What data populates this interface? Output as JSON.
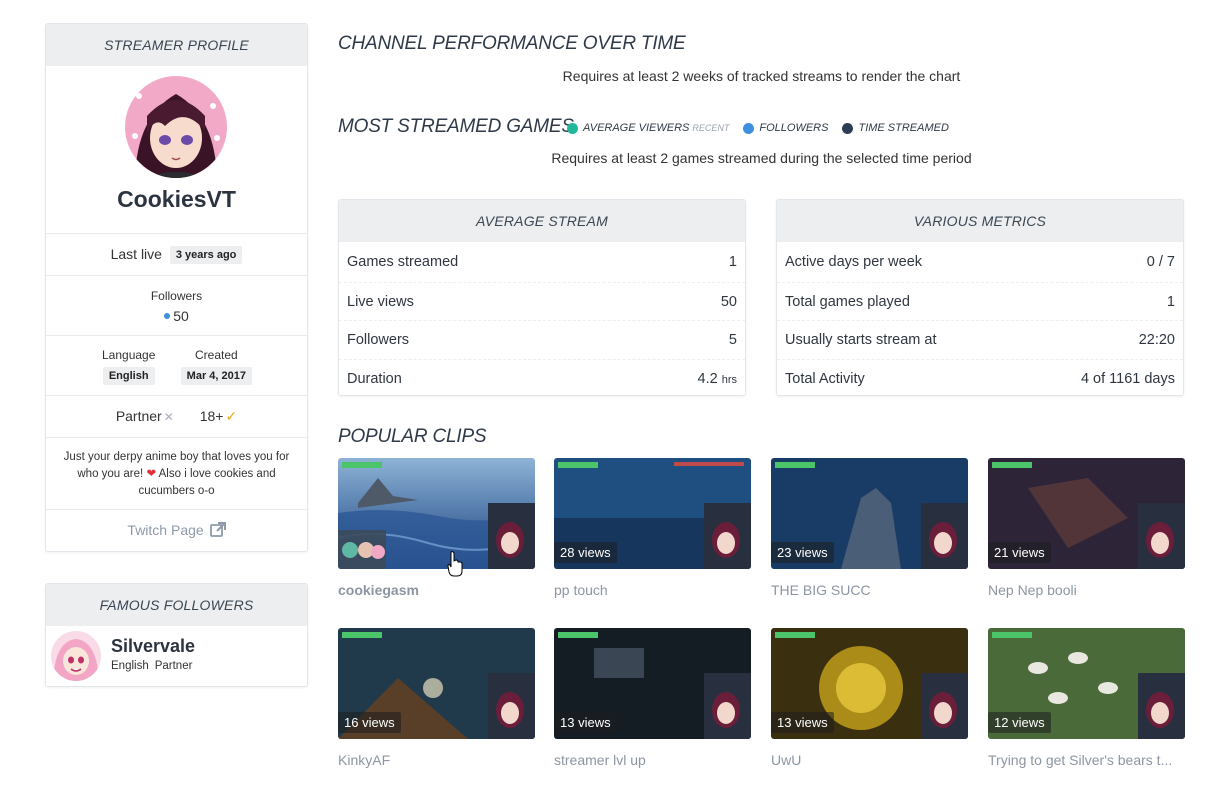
{
  "profile": {
    "header": "STREAMER PROFILE",
    "name": "CookiesVT",
    "last_live_label": "Last live",
    "last_live_value": "3 years ago",
    "followers_label": "Followers",
    "followers_value": "50",
    "language_label": "Language",
    "language_value": "English",
    "created_label": "Created",
    "created_value": "Mar 4, 2017",
    "partner_label": "Partner",
    "partner_mark": "✕",
    "age_label": "18+",
    "age_mark": "✓",
    "bio_part1": "Just your derpy anime boy that loves you for who you are!",
    "bio_heart": "❤",
    "bio_part2": "Also i love cookies and cucumbers o-o",
    "twitch_link": "Twitch Page"
  },
  "famous": {
    "header": "FAMOUS FOLLOWERS",
    "items": [
      {
        "name": "Silvervale",
        "language": "English",
        "badge": "Partner"
      }
    ]
  },
  "performance": {
    "title": "CHANNEL PERFORMANCE OVER TIME",
    "note": "Requires at least 2 weeks of tracked streams to render the chart"
  },
  "games": {
    "title": "MOST STREAMED GAMES",
    "legend": [
      {
        "label": "AVERAGE VIEWERS",
        "extra": "RECENT",
        "color": "#1fb89a"
      },
      {
        "label": "FOLLOWERS",
        "extra": "",
        "color": "#3d8fe0"
      },
      {
        "label": "TIME STREAMED",
        "extra": "",
        "color": "#2c3e57"
      }
    ],
    "note": "Requires at least 2 games streamed during the selected time period"
  },
  "average_stream": {
    "header": "AVERAGE STREAM",
    "rows": [
      {
        "label": "Games streamed",
        "value": "1",
        "unit": ""
      },
      {
        "label": "Live views",
        "value": "50",
        "unit": ""
      },
      {
        "label": "Followers",
        "value": "5",
        "unit": ""
      },
      {
        "label": "Duration",
        "value": "4.2",
        "unit": "hrs"
      }
    ]
  },
  "metrics": {
    "header": "VARIOUS METRICS",
    "rows": [
      {
        "label": "Active days per week",
        "value": "0 / 7"
      },
      {
        "label": "Total games played",
        "value": "1"
      },
      {
        "label": "Usually starts stream at",
        "value": "22:20"
      },
      {
        "label": "Total Activity",
        "value": "4 of 1161 days"
      }
    ]
  },
  "clips": {
    "title": "POPULAR CLIPS",
    "items": [
      {
        "views": "",
        "title": "cookiegasm"
      },
      {
        "views": "28 views",
        "title": "pp touch"
      },
      {
        "views": "23 views",
        "title": "THE BIG SUCC"
      },
      {
        "views": "21 views",
        "title": "Nep Nep booli"
      },
      {
        "views": "16 views",
        "title": "KinkyAF"
      },
      {
        "views": "13 views",
        "title": "streamer lvl up"
      },
      {
        "views": "13 views",
        "title": "UwU"
      },
      {
        "views": "12 views",
        "title": "Trying to get Silver's bears t..."
      }
    ]
  }
}
